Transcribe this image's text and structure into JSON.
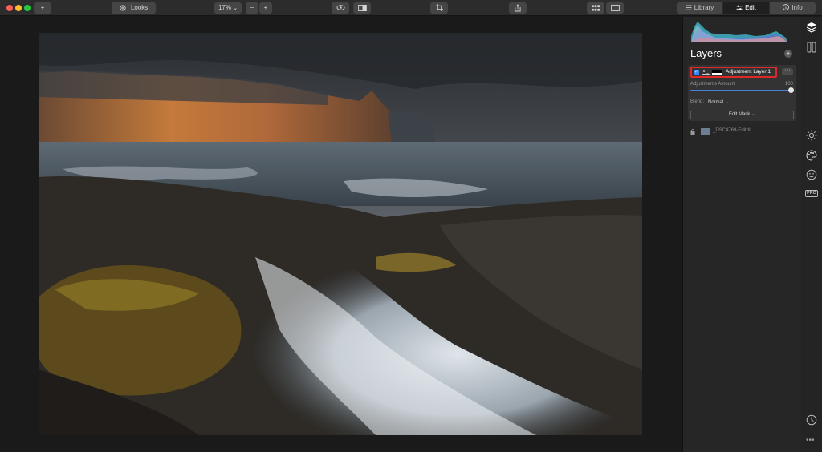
{
  "toolbar": {
    "looks_label": "Looks",
    "zoom_value": "17%",
    "zoom_caret": "⌄",
    "zoom_out_symbol": "−",
    "zoom_in_symbol": "+",
    "add_symbol": "+"
  },
  "tabs": [
    {
      "label": "Library",
      "icon": "library-icon",
      "active": false
    },
    {
      "label": "Edit",
      "icon": "edit-sliders-icon",
      "active": true
    },
    {
      "label": "Info",
      "icon": "info-icon",
      "active": false
    }
  ],
  "panel": {
    "title": "Layers",
    "add_symbol": "+",
    "layer": {
      "name": "Adjustment Layer 1",
      "checked": true,
      "more_symbol": "···",
      "amount_label": "Adjustments Amount",
      "amount_value": "100",
      "amount_fraction": 1.0,
      "blend_label": "Blend:",
      "blend_value": "Normal ⌄",
      "edit_mask_label": "Edit Mask ⌄"
    },
    "base_layer": {
      "name": "_DSC4769-Edit.tif"
    }
  },
  "strip": {
    "pro_label": "PRO",
    "more_symbol": "•••"
  },
  "colors": {
    "accent_blue": "#3f84f5",
    "highlight_red": "#e0282b",
    "panel_bg": "#262626"
  }
}
